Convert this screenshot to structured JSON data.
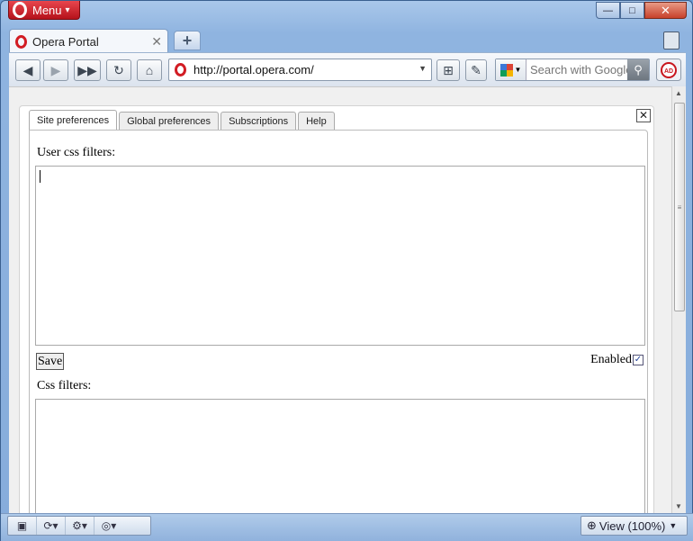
{
  "window": {
    "menu_label": "Menu",
    "caption": {
      "minimize": "—",
      "maximize": "□",
      "close": "✕"
    }
  },
  "tabs": [
    {
      "title": "Opera Portal",
      "active": true
    }
  ],
  "toolbar": {
    "address_url": "http://portal.opera.com/",
    "search_placeholder": "Search with Google"
  },
  "dialog": {
    "tabs": [
      {
        "label": "Site preferences",
        "active": true
      },
      {
        "label": "Global preferences",
        "active": false
      },
      {
        "label": "Subscriptions",
        "active": false
      },
      {
        "label": "Help",
        "active": false
      }
    ],
    "close_label": "✕",
    "user_css_label": "User css filters:",
    "user_css_value": "",
    "save_label": "Save",
    "enabled_label": "Enabled",
    "enabled_checked": true,
    "css_filters_label": "Css filters:"
  },
  "statusbar": {
    "zoom_label": "View (100%)"
  },
  "colors": {
    "accent": "#d21d24",
    "frame": "#8fb4e0"
  }
}
